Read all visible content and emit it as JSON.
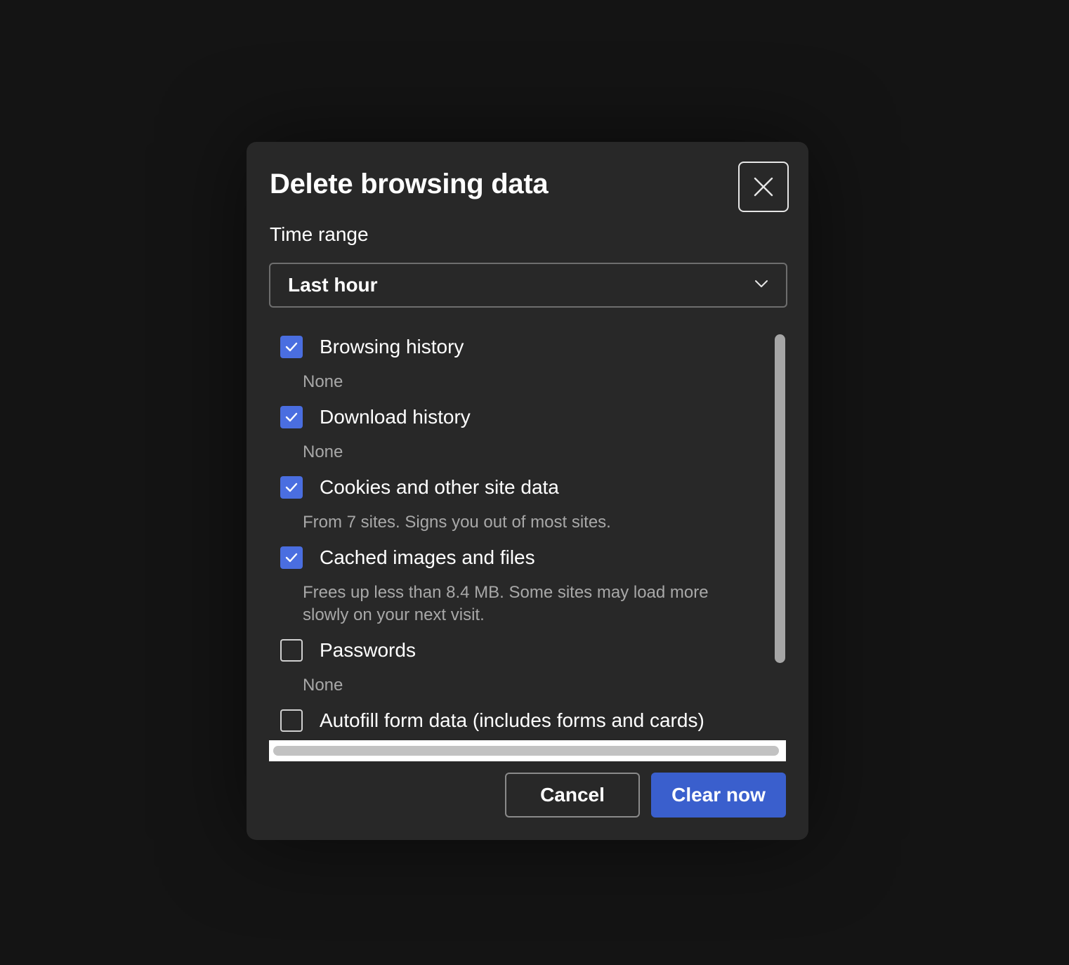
{
  "dialog": {
    "title": "Delete browsing data",
    "close_icon": "close-icon"
  },
  "time_range": {
    "label": "Time range",
    "selected": "Last hour"
  },
  "items": [
    {
      "label": "Browsing history",
      "description": "None",
      "checked": true
    },
    {
      "label": "Download history",
      "description": "None",
      "checked": true
    },
    {
      "label": "Cookies and other site data",
      "description": "From 7 sites. Signs you out of most sites.",
      "checked": true
    },
    {
      "label": "Cached images and files",
      "description": "Frees up less than 8.4 MB. Some sites may load more slowly on your next visit.",
      "checked": true
    },
    {
      "label": "Passwords",
      "description": "None",
      "checked": false
    },
    {
      "label": "Autofill form data (includes forms and cards)",
      "description": "",
      "checked": false
    }
  ],
  "buttons": {
    "cancel": "Cancel",
    "clear": "Clear now"
  },
  "colors": {
    "accent": "#3a5fcd",
    "checkbox": "#4a6ee0",
    "background": "#141414",
    "dialog": "#282828"
  }
}
